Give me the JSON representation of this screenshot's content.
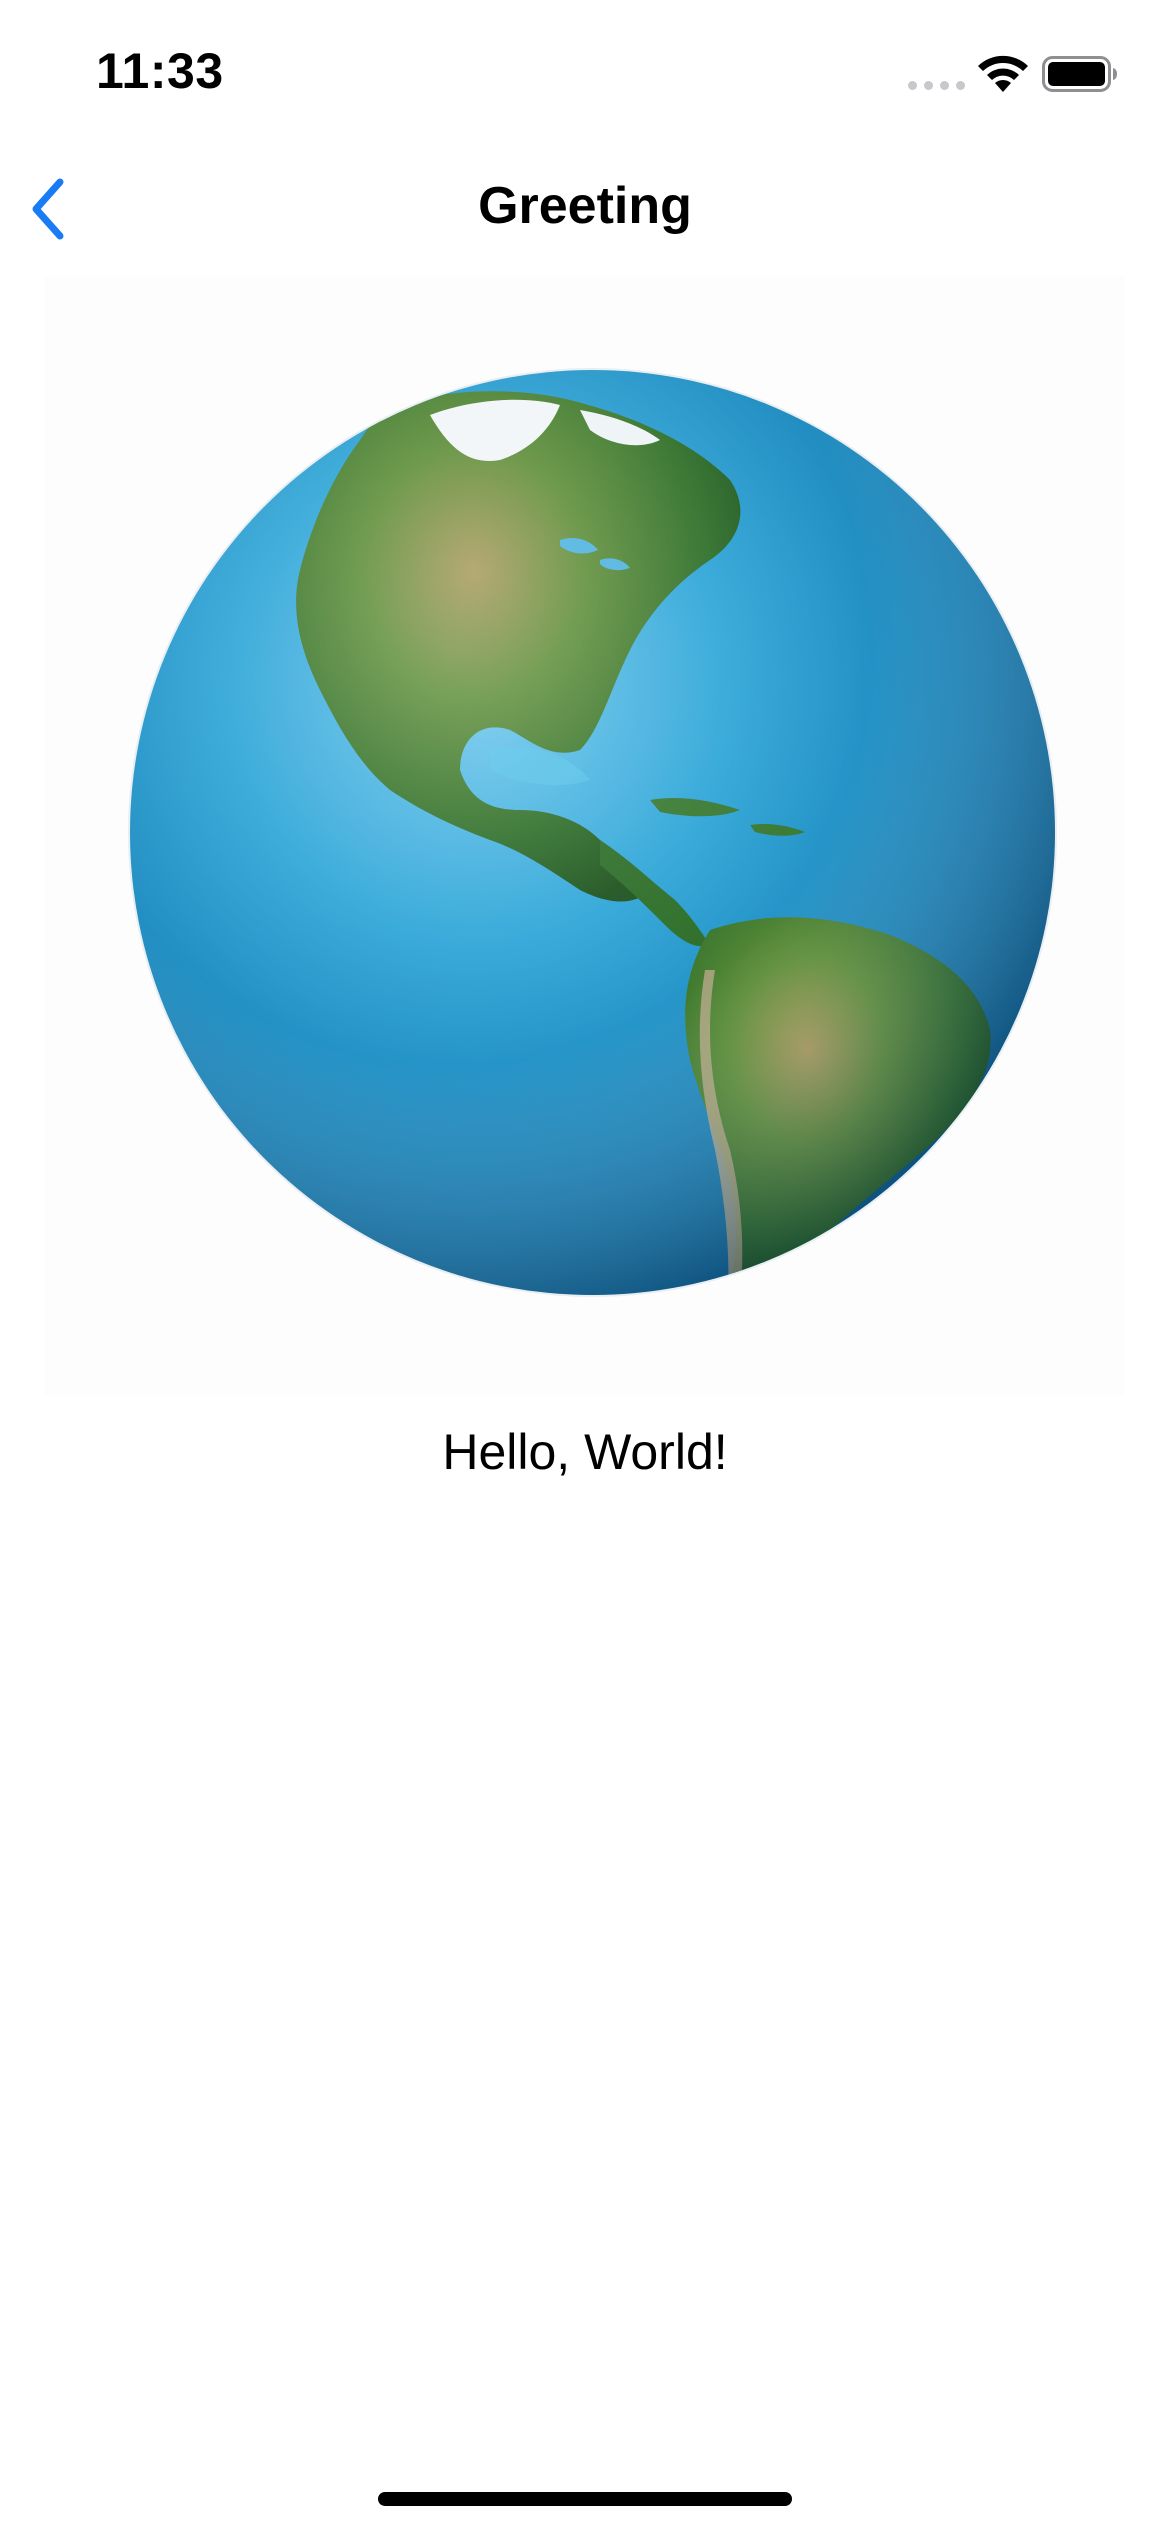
{
  "status_bar": {
    "time": "11:33",
    "icons": [
      "signal-dots-icon",
      "wifi-icon",
      "battery-icon"
    ]
  },
  "nav_bar": {
    "back_icon": "chevron-left-icon",
    "title": "Greeting"
  },
  "content": {
    "image_subject": "earth-globe",
    "greeting": "Hello, World!"
  },
  "colors": {
    "accent": "#1a7cf5",
    "background": "#ffffff",
    "text": "#000000"
  }
}
